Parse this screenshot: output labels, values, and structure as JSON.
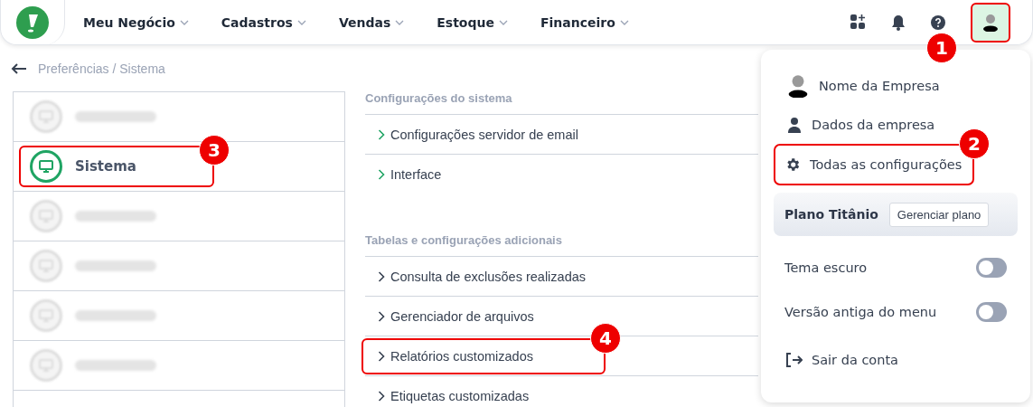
{
  "nav": {
    "items": [
      {
        "label": "Meu Negócio"
      },
      {
        "label": "Cadastros"
      },
      {
        "label": "Vendas"
      },
      {
        "label": "Estoque"
      },
      {
        "label": "Financeiro"
      }
    ],
    "callout": "1"
  },
  "breadcrumb": "Preferências / Sistema",
  "sidebar": {
    "items": [
      {
        "selected": false,
        "blurred": true
      },
      {
        "label": "Sistema",
        "selected": true,
        "blurred": false,
        "callout": "3"
      },
      {
        "selected": false,
        "blurred": true
      },
      {
        "selected": false,
        "blurred": true
      },
      {
        "selected": false,
        "blurred": true
      },
      {
        "selected": false,
        "blurred": true
      }
    ]
  },
  "sections": [
    {
      "title": "Configurações do sistema",
      "items": [
        {
          "label": "Configurações servidor de email",
          "kind": "green"
        },
        {
          "label": "Interface",
          "kind": "green"
        }
      ]
    },
    {
      "title": "Tabelas e configurações adicionais",
      "items": [
        {
          "label": "Consulta de exclusões realizadas",
          "kind": "plain"
        },
        {
          "label": "Gerenciador de arquivos",
          "kind": "plain"
        },
        {
          "label": "Relatórios customizados",
          "kind": "plain",
          "callout": "4"
        },
        {
          "label": "Etiquetas customizadas",
          "kind": "plain"
        }
      ]
    }
  ],
  "account_menu": {
    "company": "Nome da Empresa",
    "links": [
      {
        "label": "Dados da empresa",
        "kind": "person"
      },
      {
        "label": "Todas as configurações",
        "kind": "gear",
        "callout": "2"
      }
    ],
    "plan": {
      "name": "Plano Titânio",
      "button": "Gerenciar plano"
    },
    "toggles": [
      {
        "label": "Tema escuro",
        "on": false
      },
      {
        "label": "Versão antiga do menu",
        "on": false
      }
    ],
    "logout": "Sair da conta"
  }
}
